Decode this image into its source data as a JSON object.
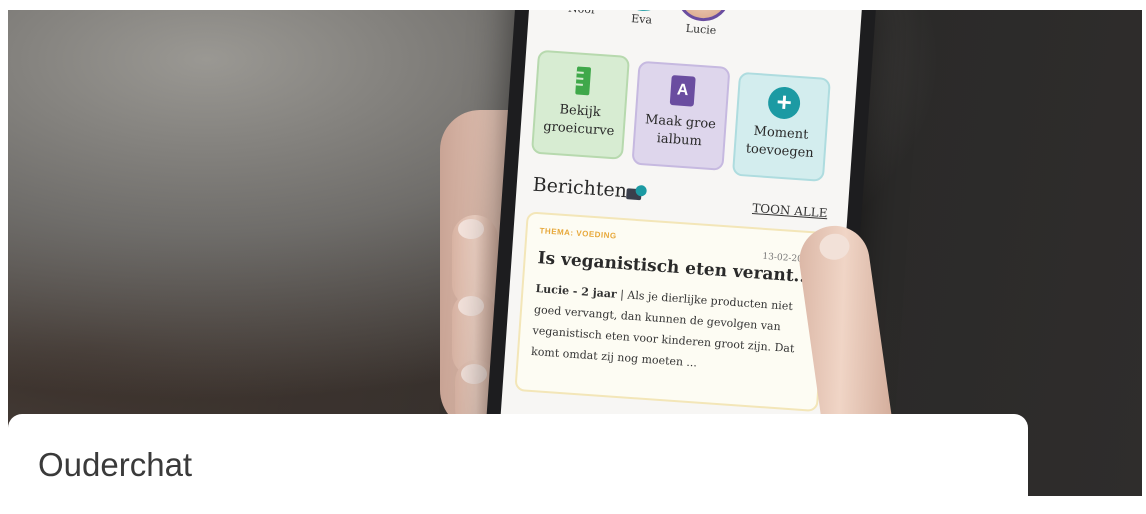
{
  "phone": {
    "avatars": [
      {
        "name": "Noor",
        "ring": "#b8336a"
      },
      {
        "name": "Eva",
        "ring": "#1c9aa3"
      },
      {
        "name": "Lucie",
        "ring": "#6a4da0"
      }
    ],
    "tiles": [
      {
        "label": "Bekijk groeicurve",
        "icon": "ruler-icon",
        "color": "#3fa84a"
      },
      {
        "label": "Maak groe ialbum",
        "icon": "photo-album-icon",
        "color": "#6a4da0"
      },
      {
        "label": "Moment toevoegen",
        "icon": "plus-circle-icon",
        "color": "#1c9aa3"
      }
    ],
    "messages": {
      "title": "Berichten",
      "show_all": "TOON ALLE",
      "card": {
        "theme": "THEMA: VOEDING",
        "date": "13-02-2023",
        "title": "Is veganistisch eten verant...",
        "author": "Lucie - 2 jaar",
        "separator": " | ",
        "excerpt": "Als je dierlijke producten niet goed vervangt, dan kunnen de gevolgen van veganistisch eten voor kinderen groot zijn. Dat komt omdat zij nog moeten ..."
      }
    }
  },
  "panel": {
    "title": "Ouderchat"
  }
}
